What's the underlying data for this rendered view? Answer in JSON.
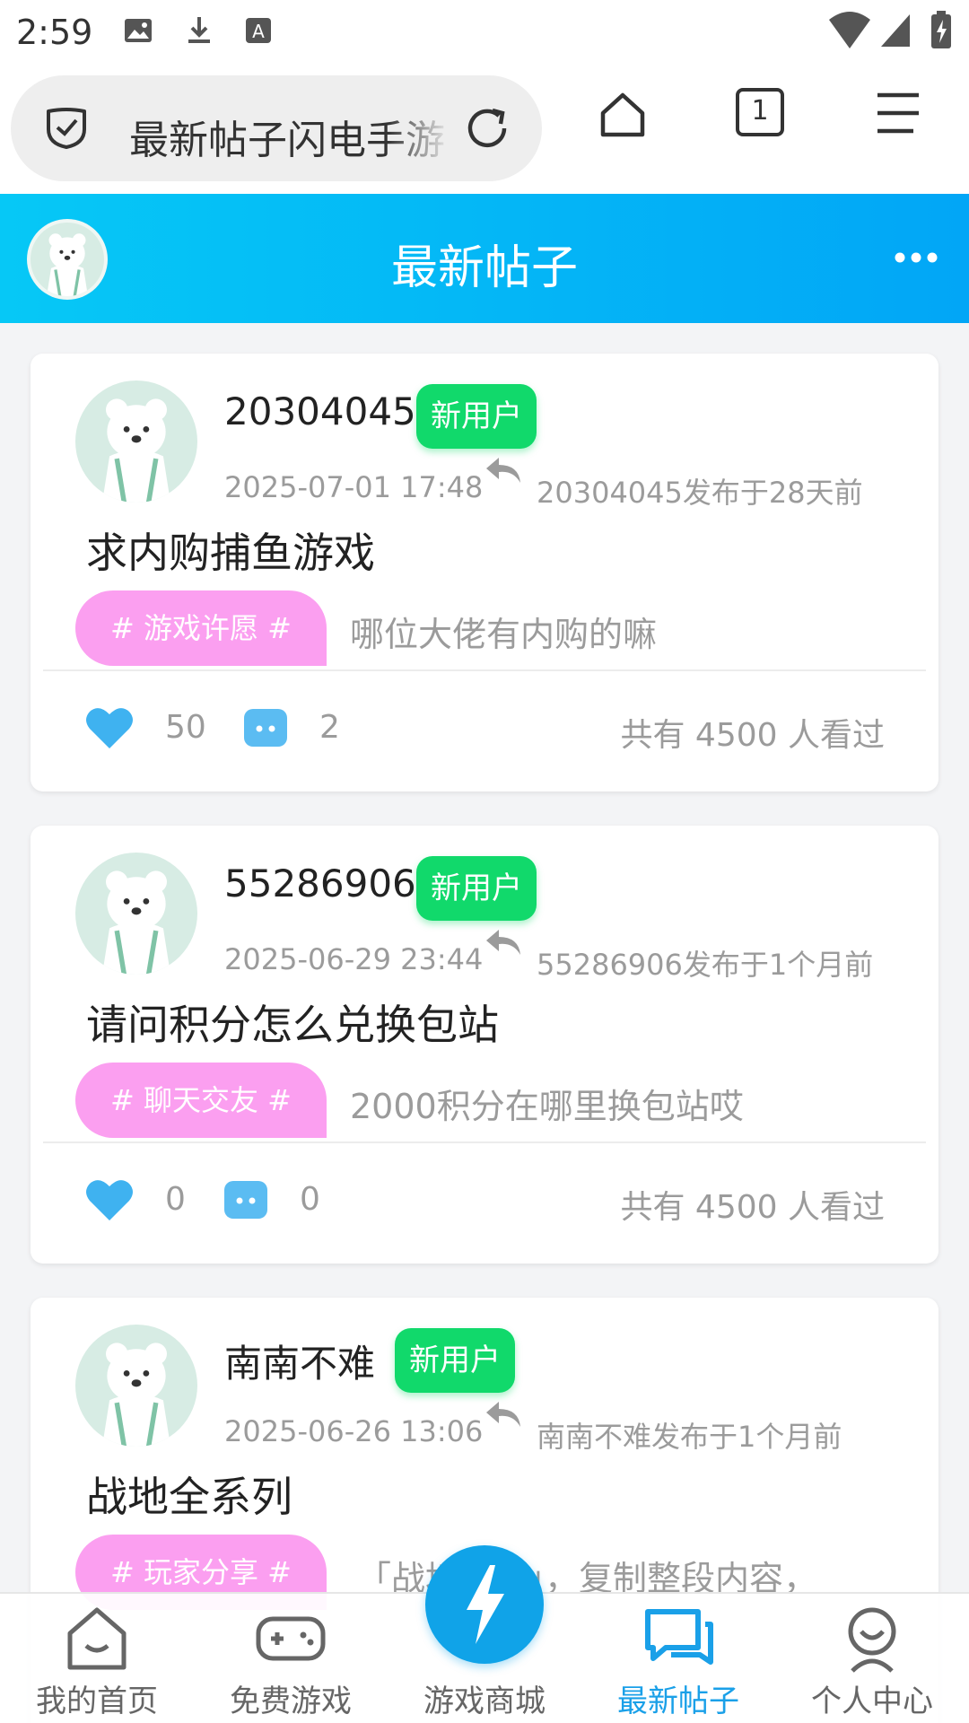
{
  "status_bar": {
    "time": "2:59"
  },
  "browser": {
    "url_text": "最新帖子闪电手游",
    "tab_count": "1"
  },
  "header": {
    "title": "最新帖子"
  },
  "posts": [
    {
      "username": "20304045",
      "badge": "新用户",
      "datetime": "2025-07-01 17:48",
      "meta": "20304045发布于28天前",
      "title": "求内购捕鱼游戏",
      "tag": "# 游戏许愿 #",
      "excerpt": "哪位大佬有内购的嘛",
      "likes": "50",
      "comments": "2",
      "views": "共有 4500 人看过"
    },
    {
      "username": "55286906",
      "badge": "新用户",
      "datetime": "2025-06-29 23:44",
      "meta": "55286906发布于1个月前",
      "title": "请问积分怎么兑换包站",
      "tag": "# 聊天交友 #",
      "excerpt": "2000积分在哪里换包站哎",
      "likes": "0",
      "comments": "0",
      "views": "共有 4500 人看过"
    },
    {
      "username": "南南不难",
      "badge": "新用户",
      "datetime": "2025-06-26 13:06",
      "meta": "南南不难发布于1个月前",
      "title": "战地全系列",
      "tag": "# 玩家分享 #",
      "excerpt": "「战地系列」，复制整段内容，",
      "likes": "",
      "comments": "",
      "views": ""
    }
  ],
  "bottom_nav": [
    {
      "label": "我的首页",
      "icon": "home-icon"
    },
    {
      "label": "免费游戏",
      "icon": "gamepad-icon"
    },
    {
      "label": "游戏商城",
      "icon": "lightning-icon"
    },
    {
      "label": "最新帖子",
      "icon": "chat-icon",
      "active": true
    },
    {
      "label": "个人中心",
      "icon": "user-icon"
    }
  ],
  "colors": {
    "header_gradient_start": "#06c8f6",
    "header_gradient_end": "#02a6f6",
    "badge_green": "#11d96b",
    "tag_pink": "#fb9ff0",
    "accent_blue": "#1aa0e8"
  }
}
